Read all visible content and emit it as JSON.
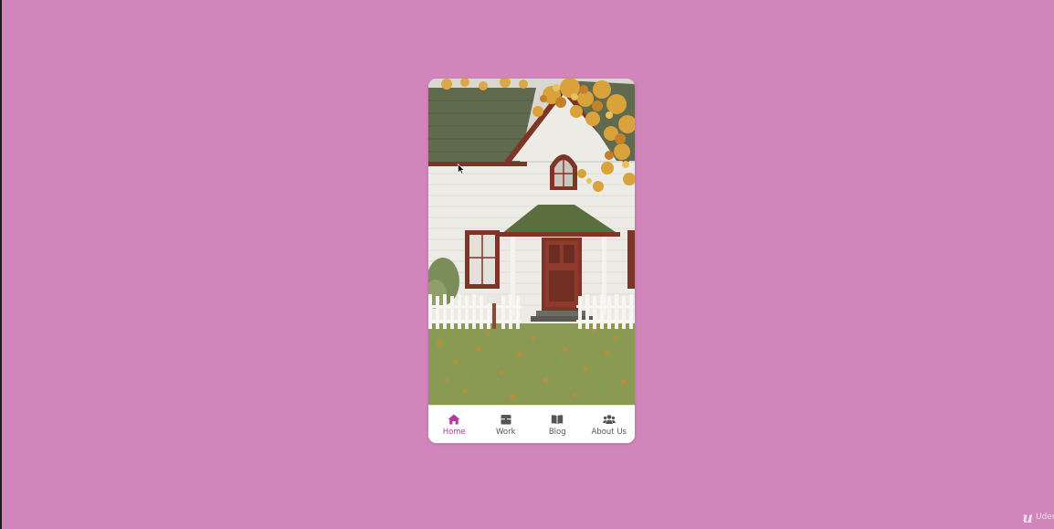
{
  "background_color": "#d085bb",
  "hero": {
    "image_description_icon": "house-photo"
  },
  "bottom_nav": {
    "accent_color": "#b53aa0",
    "inactive_color": "#555555",
    "items": [
      {
        "label": "Home",
        "icon": "home-icon",
        "active": true
      },
      {
        "label": "Work",
        "icon": "briefcase-icon",
        "active": false
      },
      {
        "label": "Blog",
        "icon": "book-icon",
        "active": false
      },
      {
        "label": "About Us",
        "icon": "users-icon",
        "active": false
      }
    ]
  },
  "watermark": {
    "mark": "u",
    "text": "Udemy"
  }
}
